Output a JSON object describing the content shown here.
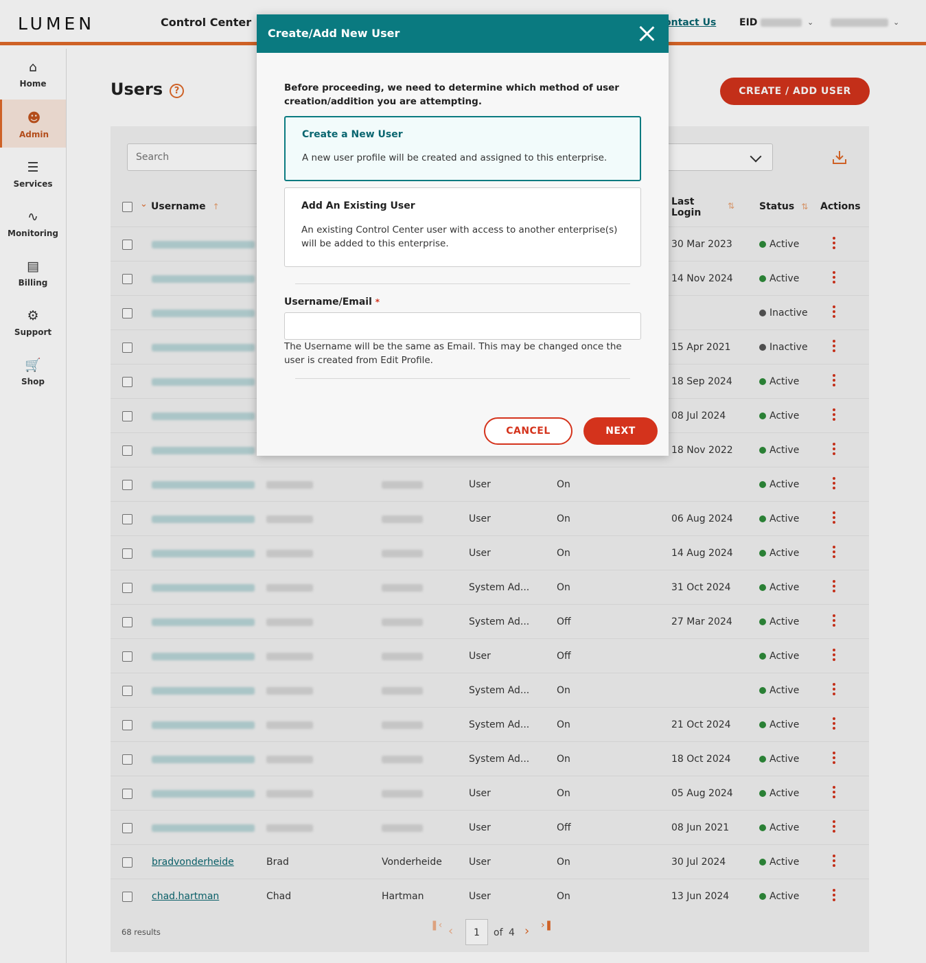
{
  "header": {
    "logo": "LUMEN",
    "app_name": "Control Center",
    "contact_link": "ontact Us",
    "eid_label": "EID"
  },
  "sidebar": {
    "items": [
      {
        "label": "Home",
        "icon": "home-icon"
      },
      {
        "label": "Admin",
        "icon": "user-icon"
      },
      {
        "label": "Services",
        "icon": "list-icon"
      },
      {
        "label": "Monitoring",
        "icon": "pulse-icon"
      },
      {
        "label": "Billing",
        "icon": "invoice-icon"
      },
      {
        "label": "Support",
        "icon": "support-icon"
      },
      {
        "label": "Shop",
        "icon": "cart-icon"
      }
    ]
  },
  "page": {
    "title": "Users",
    "create_button": "CREATE / ADD USER",
    "search_placeholder": "Search"
  },
  "table": {
    "headers": {
      "username": "Username",
      "last_login_line1": "Last",
      "last_login_line2": "Login",
      "status": "Status",
      "actions": "Actions"
    },
    "rows": [
      {
        "username": "",
        "first": "",
        "last": "",
        "role": "",
        "mfa": "",
        "last_login": "30 Mar 2023",
        "status": "Active"
      },
      {
        "username": "",
        "first": "",
        "last": "",
        "role": "",
        "mfa": "",
        "last_login": "14 Nov 2024",
        "status": "Active"
      },
      {
        "username": "",
        "first": "",
        "last": "",
        "role": "",
        "mfa": "",
        "last_login": "",
        "status": "Inactive"
      },
      {
        "username": "",
        "first": "",
        "last": "",
        "role": "",
        "mfa": "",
        "last_login": "15 Apr 2021",
        "status": "Inactive"
      },
      {
        "username": "",
        "first": "",
        "last": "",
        "role": "",
        "mfa": "",
        "last_login": "18 Sep 2024",
        "status": "Active"
      },
      {
        "username": "",
        "first": "",
        "last": "",
        "role": "",
        "mfa": "",
        "last_login": "08 Jul 2024",
        "status": "Active"
      },
      {
        "username": "",
        "first": "",
        "last": "",
        "role": "",
        "mfa": "",
        "last_login": "18 Nov 2022",
        "status": "Active"
      },
      {
        "username": "",
        "first": "",
        "last": "",
        "role": "User",
        "mfa": "On",
        "last_login": "",
        "status": "Active"
      },
      {
        "username": "",
        "first": "",
        "last": "",
        "role": "User",
        "mfa": "On",
        "last_login": "06 Aug 2024",
        "status": "Active"
      },
      {
        "username": "",
        "first": "",
        "last": "",
        "role": "User",
        "mfa": "On",
        "last_login": "14 Aug 2024",
        "status": "Active"
      },
      {
        "username": "",
        "first": "",
        "last": "",
        "role": "System Ad...",
        "mfa": "On",
        "last_login": "31 Oct 2024",
        "status": "Active"
      },
      {
        "username": "",
        "first": "",
        "last": "",
        "role": "System Ad...",
        "mfa": "Off",
        "last_login": "27 Mar 2024",
        "status": "Active"
      },
      {
        "username": "",
        "first": "",
        "last": "",
        "role": "User",
        "mfa": "Off",
        "last_login": "",
        "status": "Active"
      },
      {
        "username": "",
        "first": "",
        "last": "",
        "role": "System Ad...",
        "mfa": "On",
        "last_login": "",
        "status": "Active"
      },
      {
        "username": "",
        "first": "",
        "last": "",
        "role": "System Ad...",
        "mfa": "On",
        "last_login": "21 Oct 2024",
        "status": "Active"
      },
      {
        "username": "",
        "first": "",
        "last": "",
        "role": "System Ad...",
        "mfa": "On",
        "last_login": "18 Oct 2024",
        "status": "Active"
      },
      {
        "username": "",
        "first": "",
        "last": "",
        "role": "User",
        "mfa": "On",
        "last_login": "05 Aug 2024",
        "status": "Active"
      },
      {
        "username": "",
        "first": "",
        "last": "",
        "role": "User",
        "mfa": "Off",
        "last_login": "08 Jun 2021",
        "status": "Active"
      },
      {
        "username": "bradvonderheide",
        "first": "Brad",
        "last": "Vonderheide",
        "role": "User",
        "mfa": "On",
        "last_login": "30 Jul 2024",
        "status": "Active"
      },
      {
        "username": "chad.hartman",
        "first": "Chad",
        "last": "Hartman",
        "role": "User",
        "mfa": "On",
        "last_login": "13 Jun 2024",
        "status": "Active"
      }
    ]
  },
  "pagination": {
    "results": "68 results",
    "current_page": "1",
    "of_label": "of",
    "total_pages": "4"
  },
  "modal": {
    "title": "Create/Add New User",
    "intro": "Before proceeding, we need to determine which method of user creation/addition you are attempting.",
    "option_new_title": "Create a New User",
    "option_new_desc": "A new user profile will be created and assigned to this enterprise.",
    "option_existing_title": "Add An Existing User",
    "option_existing_desc": "An existing Control Center user with access to another enterprise(s) will be added to this enterprise.",
    "field_label": "Username/Email",
    "required_mark": "*",
    "field_value": "",
    "field_help": "The Username will be the same as Email. This may be changed once the user is created from Edit Profile.",
    "cancel": "CANCEL",
    "next": "NEXT"
  },
  "colors": {
    "brand_orange": "#e06a2a",
    "primary_red": "#d4331c",
    "teal": "#0a7a80",
    "active_green": "#2e8b3a",
    "inactive_gray": "#555555"
  }
}
